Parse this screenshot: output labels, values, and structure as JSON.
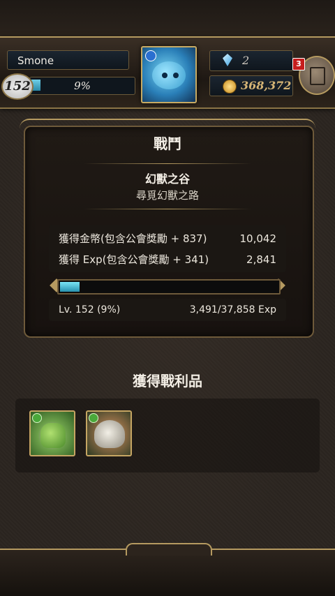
{
  "player": {
    "name": "Smone",
    "level": "152",
    "exp_percent_label": "9%",
    "exp_fraction": 0.09,
    "gems": "2",
    "coins": "368,372",
    "notifications": "3"
  },
  "battle": {
    "title": "戰鬥",
    "stage_name": "幻獸之谷",
    "stage_subtitle": "尋覓幻獸之路",
    "rewards": [
      {
        "label": "獲得金幣(包含公會獎勵 + 837)",
        "value": "10,042"
      },
      {
        "label": "獲得 Exp(包含公會獎勵 + 341)",
        "value": "2,841"
      }
    ],
    "progress_fraction": 0.09,
    "level_label": "Lv. 152 (9%)",
    "exp_total": "3,491/37,858 Exp"
  },
  "loot": {
    "title": "獲得戰利品",
    "items": [
      {
        "name": "green-dragon-card-icon",
        "attribute_color": "#4aa83a"
      },
      {
        "name": "wolf-card-icon",
        "attribute_color": "#4aa83a"
      }
    ]
  },
  "colors": {
    "accent_gold": "#b59a60",
    "exp_cyan": "#2892b0",
    "badge_red": "#c51d1d"
  }
}
